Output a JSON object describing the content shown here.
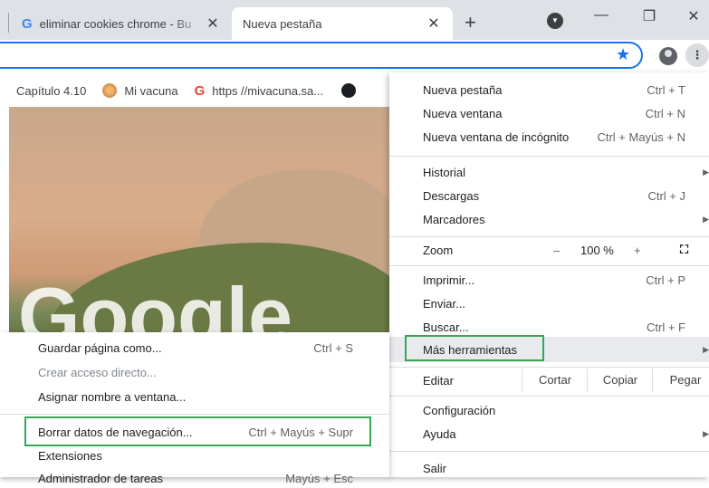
{
  "tabs": [
    {
      "title": "eliminar cookies chrome - Bu",
      "close": "✕"
    },
    {
      "title": "Nueva pestaña",
      "close": "✕"
    }
  ],
  "new_tab_label": "+",
  "window_controls": {
    "minimize": "—",
    "restore": "❐",
    "close": "✕"
  },
  "bookmarks": [
    {
      "label": "Capítulo 4.10"
    },
    {
      "label": "Mi vacuna"
    },
    {
      "label": "https //mivacuna.sa..."
    }
  ],
  "page": {
    "logo_text": "Google"
  },
  "main_menu": {
    "nueva_pestana": {
      "label": "Nueva pestaña",
      "shortcut": "Ctrl + T"
    },
    "nueva_ventana": {
      "label": "Nueva ventana",
      "shortcut": "Ctrl + N"
    },
    "incognito": {
      "label": "Nueva ventana de incógnito",
      "shortcut": "Ctrl + Mayús + N"
    },
    "historial": {
      "label": "Historial"
    },
    "descargas": {
      "label": "Descargas",
      "shortcut": "Ctrl + J"
    },
    "marcadores": {
      "label": "Marcadores"
    },
    "zoom": {
      "label": "Zoom",
      "minus": "–",
      "value": "100 %",
      "plus": "+"
    },
    "imprimir": {
      "label": "Imprimir...",
      "shortcut": "Ctrl + P"
    },
    "enviar": {
      "label": "Enviar..."
    },
    "buscar": {
      "label": "Buscar...",
      "shortcut": "Ctrl + F"
    },
    "mas_herramientas": {
      "label": "Más herramientas"
    },
    "editar": {
      "label": "Editar",
      "cortar": "Cortar",
      "copiar": "Copiar",
      "pegar": "Pegar"
    },
    "configuracion": {
      "label": "Configuración"
    },
    "ayuda": {
      "label": "Ayuda"
    },
    "salir": {
      "label": "Salir"
    }
  },
  "sub_menu": {
    "guardar": {
      "label": "Guardar página como...",
      "shortcut": "Ctrl + S"
    },
    "acceso": {
      "label": "Crear acceso directo..."
    },
    "asignar": {
      "label": "Asignar nombre a ventana..."
    },
    "borrar": {
      "label": "Borrar datos de navegación...",
      "shortcut": "Ctrl + Mayús + Supr"
    },
    "extensiones": {
      "label": "Extensiones"
    },
    "admin": {
      "label": "Administrador de tareas",
      "shortcut": "Mayús + Esc"
    }
  },
  "colors": {
    "highlight_green": "#35a853",
    "focus_blue": "#1a73e8"
  }
}
